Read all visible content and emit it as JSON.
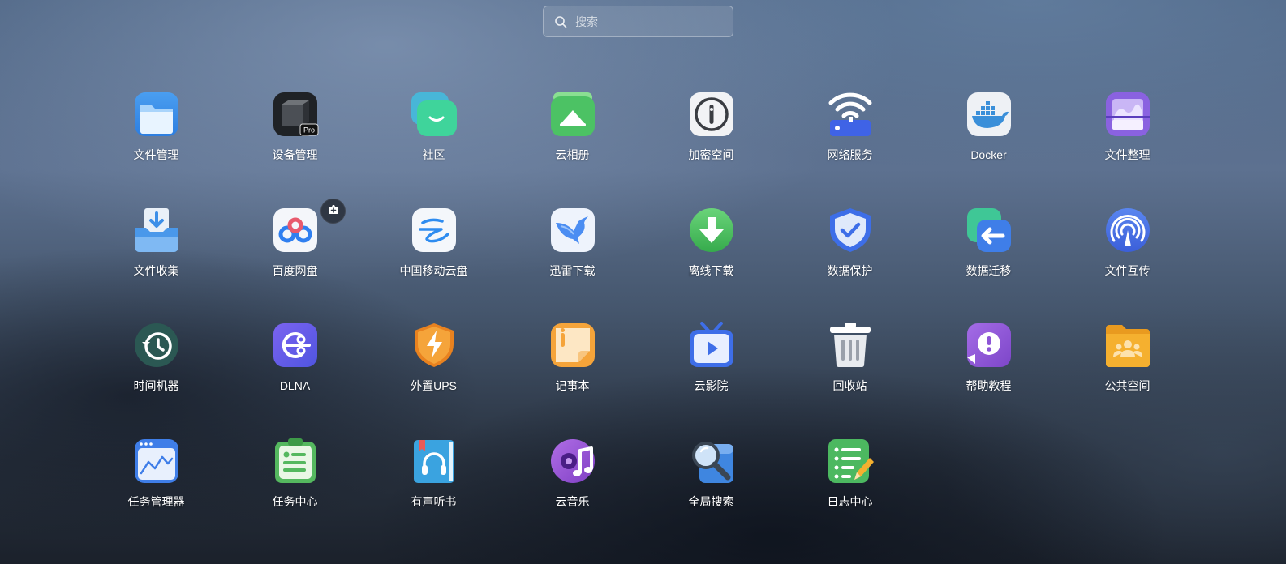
{
  "search": {
    "placeholder": "搜索",
    "icon": "search-icon"
  },
  "apps": [
    {
      "label": "文件管理",
      "icon": "folder-icon",
      "accent": "#3d8fe8"
    },
    {
      "label": "设备管理",
      "icon": "device-pro-icon",
      "badge": "Pro",
      "accent": "#2a2a2a"
    },
    {
      "label": "社区",
      "icon": "community-chat-icon",
      "accent": "#3cc79a"
    },
    {
      "label": "云相册",
      "icon": "photo-album-icon",
      "accent": "#4cc264"
    },
    {
      "label": "加密空间",
      "icon": "encrypted-lock-icon",
      "accent": "#f2f3f5"
    },
    {
      "label": "网络服务",
      "icon": "wifi-router-icon",
      "accent": "#3f63e6"
    },
    {
      "label": "Docker",
      "icon": "docker-whale-icon",
      "accent": "#3a8fd9"
    },
    {
      "label": "文件整理",
      "icon": "file-organize-icon",
      "accent": "#8a62e0"
    },
    {
      "label": "文件收集",
      "icon": "file-collect-icon",
      "accent": "#4a98ea"
    },
    {
      "label": "百度网盘",
      "icon": "baidu-netdisk-icon",
      "accent": "#2f7ff0"
    },
    {
      "label": "中国移动云盘",
      "icon": "china-mobile-cloud-icon",
      "accent": "#2e8cf0"
    },
    {
      "label": "迅雷下载",
      "icon": "thunder-bird-icon",
      "accent": "#4b8df2"
    },
    {
      "label": "离线下载",
      "icon": "offline-download-icon",
      "accent": "#45be58"
    },
    {
      "label": "数据保护",
      "icon": "shield-check-icon",
      "accent": "#3d6ee8"
    },
    {
      "label": "数据迁移",
      "icon": "data-migrate-icon",
      "accent": "#3f7ee8"
    },
    {
      "label": "文件互传",
      "icon": "airdrop-icon",
      "accent": "#4b74ea"
    },
    {
      "label": "时间机器",
      "icon": "time-machine-icon",
      "accent": "#2f5d58"
    },
    {
      "label": "DLNA",
      "icon": "dlna-icon",
      "accent": "#6a5ae8"
    },
    {
      "label": "外置UPS",
      "icon": "ups-lightning-icon",
      "accent": "#f0962c"
    },
    {
      "label": "记事本",
      "icon": "notepad-icon",
      "accent": "#f5a43a"
    },
    {
      "label": "云影院",
      "icon": "cloud-cinema-tv-icon",
      "accent": "#3e6ee8"
    },
    {
      "label": "回收站",
      "icon": "trash-icon",
      "accent": "#e8ebef"
    },
    {
      "label": "帮助教程",
      "icon": "help-tutorial-icon",
      "accent": "#8d55d6"
    },
    {
      "label": "公共空间",
      "icon": "public-folder-icon",
      "accent": "#f5b02f"
    },
    {
      "label": "任务管理器",
      "icon": "task-manager-icon",
      "accent": "#3f7ee8"
    },
    {
      "label": "任务中心",
      "icon": "task-center-icon",
      "accent": "#55b85f"
    },
    {
      "label": "有声听书",
      "icon": "audiobook-icon",
      "accent": "#3aa3e0"
    },
    {
      "label": "云音乐",
      "icon": "cloud-music-icon",
      "accent": "#9b59d6"
    },
    {
      "label": "全局搜索",
      "icon": "global-search-icon",
      "accent": "#3f86e0"
    },
    {
      "label": "日志中心",
      "icon": "log-center-icon",
      "accent": "#4cb860"
    }
  ],
  "add_badge": {
    "icon": "add-plus-icon"
  }
}
